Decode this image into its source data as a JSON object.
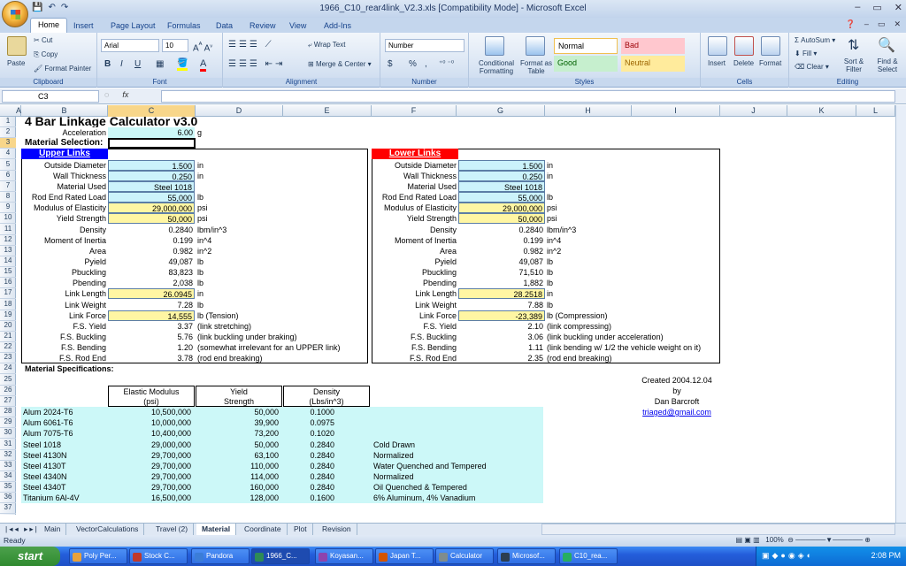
{
  "window": {
    "title": "1966_C10_rear4link_V2.3.xls  [Compatibility Mode] - Microsoft Excel",
    "controls": [
      "–",
      "▭",
      "✕"
    ]
  },
  "ribbon_tabs": [
    "Home",
    "Insert",
    "Page Layout",
    "Formulas",
    "Data",
    "Review",
    "View",
    "Add-Ins"
  ],
  "ribbon": {
    "clipboard": {
      "paste": "Paste",
      "cut": "Cut",
      "copy": "Copy",
      "format_painter": "Format Painter",
      "label": "Clipboard"
    },
    "font": {
      "name": "Arial",
      "size": "10",
      "label": "Font",
      "bold": "B",
      "italic": "I",
      "underline": "U"
    },
    "alignment": {
      "wrap": "Wrap Text",
      "merge": "Merge & Center",
      "label": "Alignment"
    },
    "number": {
      "format": "Number",
      "currency": "$",
      "percent": "%",
      "comma": ",",
      "label": "Number"
    },
    "styles": {
      "conditional": "Conditional Formatting",
      "format_table": "Format as Table",
      "normal": "Normal",
      "bad": "Bad",
      "good": "Good",
      "neutral": "Neutral",
      "label": "Styles"
    },
    "cells": {
      "insert": "Insert",
      "delete": "Delete",
      "format": "Format",
      "label": "Cells"
    },
    "editing": {
      "autosum": "AutoSum",
      "fill": "Fill",
      "clear": "Clear",
      "sort": "Sort & Filter",
      "find": "Find & Select",
      "label": "Editing"
    }
  },
  "formula_bar": {
    "name_box": "C3",
    "fx": "fx",
    "formula": ""
  },
  "columns": [
    "A",
    "B",
    "C",
    "D",
    "E",
    "F",
    "G",
    "H",
    "I",
    "J",
    "K",
    "L"
  ],
  "rows": [
    "1",
    "2",
    "3",
    "4",
    "5",
    "6",
    "7",
    "8",
    "9",
    "10",
    "11",
    "12",
    "13",
    "14",
    "15",
    "16",
    "17",
    "18",
    "19",
    "20",
    "21",
    "22",
    "23",
    "24",
    "25",
    "26",
    "27",
    "28",
    "29",
    "30",
    "31",
    "32",
    "33",
    "34",
    "35",
    "36",
    "37"
  ],
  "sheet": {
    "title": "4 Bar Linkage Calculator v3.0",
    "acceleration_label": "Acceleration",
    "acceleration_value": "6.00",
    "acceleration_unit": "g",
    "material_selection": "Material Selection:",
    "upper": {
      "header": "Upper Links",
      "rows": [
        {
          "label": "Outside Diameter",
          "value": "1.500",
          "unit": "in"
        },
        {
          "label": "Wall Thickness",
          "value": "0.250",
          "unit": "in"
        },
        {
          "label": "Material Used",
          "value": "Steel 1018",
          "unit": ""
        },
        {
          "label": "Rod End Rated Load",
          "value": "55,000",
          "unit": "lb"
        },
        {
          "label": "Modulus of Elasticity",
          "value": "29,000,000",
          "unit": "psi"
        },
        {
          "label": "Yield Strength",
          "value": "50,000",
          "unit": "psi"
        },
        {
          "label": "Density",
          "value": "0.2840",
          "unit": "lbm/in^3"
        },
        {
          "label": "Moment of Inertia",
          "value": "0.199",
          "unit": "in^4"
        },
        {
          "label": "Area",
          "value": "0.982",
          "unit": "in^2"
        },
        {
          "label": "Pyield",
          "value": "49,087",
          "unit": "lb"
        },
        {
          "label": "Pbuckling",
          "value": "83,823",
          "unit": "lb"
        },
        {
          "label": "Pbending",
          "value": "2,038",
          "unit": "lb"
        },
        {
          "label": "Link Length",
          "value": "26.0945",
          "unit": "in"
        },
        {
          "label": "Link Weight",
          "value": "7.28",
          "unit": "lb"
        },
        {
          "label": "Link Force",
          "value": "14,555",
          "unit": "lb (Tension)"
        },
        {
          "label": "F.S. Yield",
          "value": "3.37",
          "unit": "(link stretching)"
        },
        {
          "label": "F.S. Buckling",
          "value": "5.76",
          "unit": "(link buckling under braking)"
        },
        {
          "label": "F.S. Bending",
          "value": "1.20",
          "unit": "(somewhat irrelevant for an UPPER link)"
        },
        {
          "label": "F.S. Rod End",
          "value": "3.78",
          "unit": "(rod end breaking)"
        }
      ]
    },
    "lower": {
      "header": "Lower Links",
      "rows": [
        {
          "label": "Outside Diameter",
          "value": "1.500",
          "unit": "in"
        },
        {
          "label": "Wall Thickness",
          "value": "0.250",
          "unit": "in"
        },
        {
          "label": "Material Used",
          "value": "Steel 1018",
          "unit": ""
        },
        {
          "label": "Rod End Rated Load",
          "value": "55,000",
          "unit": "lb"
        },
        {
          "label": "Modulus of Elasticity",
          "value": "29,000,000",
          "unit": "psi"
        },
        {
          "label": "Yield Strength",
          "value": "50,000",
          "unit": "psi"
        },
        {
          "label": "Density",
          "value": "0.2840",
          "unit": "lbm/in^3"
        },
        {
          "label": "Moment of Inertia",
          "value": "0.199",
          "unit": "in^4"
        },
        {
          "label": "Area",
          "value": "0.982",
          "unit": "in^2"
        },
        {
          "label": "Pyield",
          "value": "49,087",
          "unit": "lb"
        },
        {
          "label": "Pbuckling",
          "value": "71,510",
          "unit": "lb"
        },
        {
          "label": "Pbending",
          "value": "1,882",
          "unit": "lb"
        },
        {
          "label": "Link Length",
          "value": "28.2518",
          "unit": "in"
        },
        {
          "label": "Link Weight",
          "value": "7.88",
          "unit": "lb"
        },
        {
          "label": "Link Force",
          "value": "-23,389",
          "unit": "lb (Compression)"
        },
        {
          "label": "F.S. Yield",
          "value": "2.10",
          "unit": "(link compressing)"
        },
        {
          "label": "F.S. Buckling",
          "value": "3.06",
          "unit": "(link buckling under acceleration)"
        },
        {
          "label": "F.S. Bending",
          "value": "1.11",
          "unit": "(link bending w/ 1/2 the vehicle weight on it)"
        },
        {
          "label": "F.S. Rod End",
          "value": "2.35",
          "unit": "(rod end breaking)"
        }
      ]
    },
    "materials_title": "Material Specifications:",
    "materials_headers": [
      [
        "Elastic Modulus",
        "(psi)"
      ],
      [
        "Yield",
        "Strength"
      ],
      [
        "Density",
        "(Lbs/in^3)"
      ]
    ],
    "materials": [
      {
        "name": "Alum 2024-T6",
        "modulus": "10,500,000",
        "yield": "50,000",
        "density": "0.1000",
        "note": ""
      },
      {
        "name": "Alum 6061-T6",
        "modulus": "10,000,000",
        "yield": "39,900",
        "density": "0.0975",
        "note": ""
      },
      {
        "name": "Alum 7075-T6",
        "modulus": "10,400,000",
        "yield": "73,200",
        "density": "0.1020",
        "note": ""
      },
      {
        "name": "Steel 1018",
        "modulus": "29,000,000",
        "yield": "50,000",
        "density": "0.2840",
        "note": "Cold Drawn"
      },
      {
        "name": "Steel 4130N",
        "modulus": "29,700,000",
        "yield": "63,100",
        "density": "0.2840",
        "note": "Normalized"
      },
      {
        "name": "Steel 4130T",
        "modulus": "29,700,000",
        "yield": "110,000",
        "density": "0.2840",
        "note": "Water Quenched and Tempered"
      },
      {
        "name": "Steel 4340N",
        "modulus": "29,700,000",
        "yield": "114,000",
        "density": "0.2840",
        "note": "Normalized"
      },
      {
        "name": "Steel 4340T",
        "modulus": "29,700,000",
        "yield": "160,000",
        "density": "0.2840",
        "note": "Oil Quenched & Tempered"
      },
      {
        "name": "Titanium 6Al-4V",
        "modulus": "16,500,000",
        "yield": "128,000",
        "density": "0.1600",
        "note": "6% Aluminum, 4% Vanadium"
      }
    ],
    "credit": {
      "created": "Created 2004.12.04",
      "by": "by",
      "name": "Dan Barcroft",
      "email": "triaged@gmail.com"
    }
  },
  "sheet_tabs": [
    "Main",
    "VectorCalculations",
    "Travel (2)",
    "Material",
    "Coordinate",
    "Plot",
    "Revision"
  ],
  "active_sheet": "Material",
  "status": {
    "ready": "Ready",
    "zoom": "100%"
  },
  "taskbar": {
    "start": "start",
    "items": [
      "Poly Per...",
      "Stock C...",
      "Pandora",
      "1966_C...",
      "Koyasan...",
      "Japan T...",
      "Calculator",
      "Microsof...",
      "C10_rea..."
    ],
    "clock": "2:08 PM"
  },
  "colors": {
    "upper_header": "#0000ff",
    "lower_header": "#ff0000",
    "input_blue": "#ccf3fb",
    "input_yellow": "#fff6a3"
  }
}
